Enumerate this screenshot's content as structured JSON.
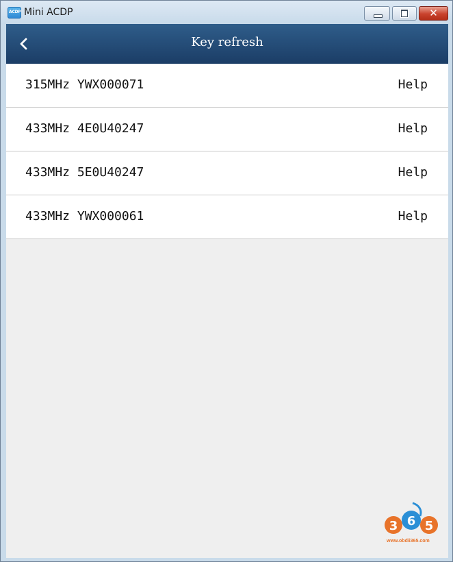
{
  "window": {
    "title": "Mini ACDP",
    "icon_name": "acdp-app-icon",
    "icon_text": "ACDP",
    "controls": {
      "minimize": "minimize-icon",
      "maximize": "maximize-icon",
      "close": "close-icon",
      "close_glyph": "✕"
    }
  },
  "header": {
    "title": "Key refresh",
    "back_icon": "chevron-left-icon"
  },
  "list": {
    "items": [
      {
        "label": "315MHz YWX000071",
        "action": "Help"
      },
      {
        "label": "433MHz 4E0U40247",
        "action": "Help"
      },
      {
        "label": "433MHz 5E0U40247",
        "action": "Help"
      },
      {
        "label": "433MHz YWX000061",
        "action": "Help"
      }
    ]
  },
  "watermark": {
    "text": "365",
    "url": "www.obdii365.com"
  },
  "colors": {
    "header_bg": "#1f4570",
    "list_bg": "#ffffff",
    "page_bg": "#efefef",
    "watermark_orange": "#e8732a",
    "watermark_blue": "#2b8fd6"
  }
}
